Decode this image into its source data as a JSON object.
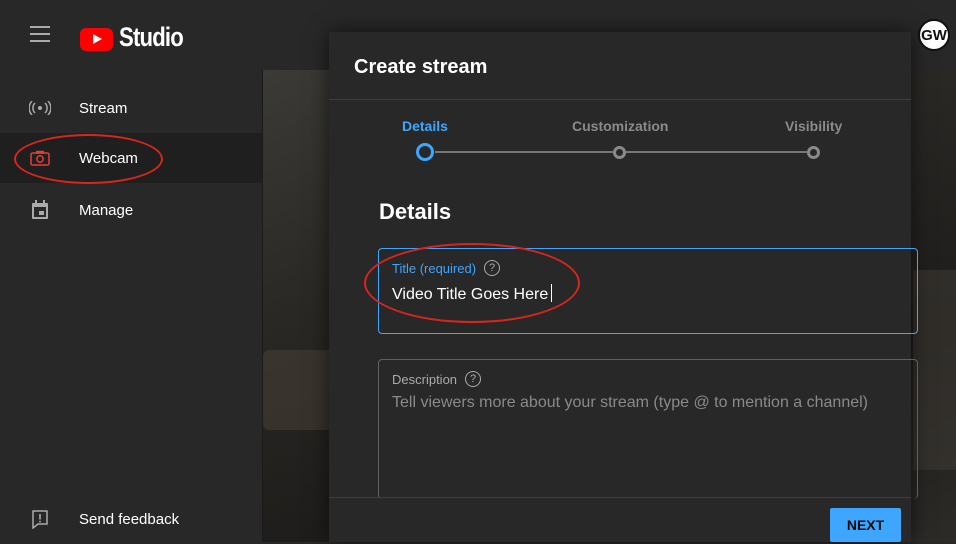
{
  "app": {
    "brand": "Studio",
    "avatar_initials": "GW"
  },
  "sidebar": {
    "items": [
      {
        "label": "Stream",
        "icon": "live-signal-icon"
      },
      {
        "label": "Webcam",
        "icon": "camera-icon",
        "active": true
      },
      {
        "label": "Manage",
        "icon": "calendar-icon"
      }
    ],
    "feedback_label": "Send feedback"
  },
  "dialog": {
    "title": "Create stream",
    "steps": [
      {
        "label": "Details",
        "active": true
      },
      {
        "label": "Customization",
        "active": false
      },
      {
        "label": "Visibility",
        "active": false
      }
    ],
    "section_heading": "Details",
    "title_field": {
      "label": "Title (required)",
      "value": "Video Title Goes Here",
      "help": "?"
    },
    "description_field": {
      "label": "Description",
      "placeholder": "Tell viewers more about your stream (type @ to mention a channel)",
      "help": "?"
    },
    "next_label": "NEXT"
  },
  "colors": {
    "accent": "#3ea6ff",
    "annotation": "#d8261c",
    "brand_red": "#ff0000"
  }
}
